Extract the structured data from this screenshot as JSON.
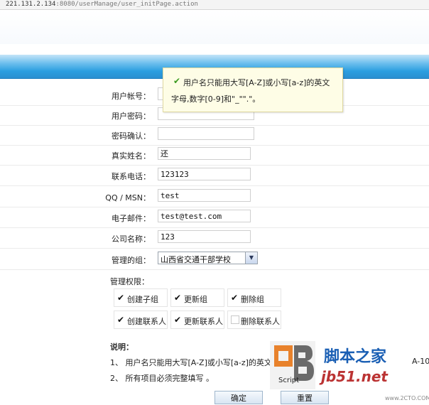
{
  "browser": {
    "url_host": "221.131.2.134",
    "url_path": ":8080/userManage/user_initPage.action"
  },
  "form": {
    "account_label": "用户帐号：",
    "password_label": "用户密码：",
    "confirm_label": "密码确认：",
    "realname_label": "真实姓名：",
    "realname_value": "还",
    "phone_label": "联系电话：",
    "phone_value": "123123",
    "qq_label": "QQ / MSN：",
    "qq_value": "test",
    "email_label": "电子邮件：",
    "email_value": "test@test.com",
    "company_label": "公司名称：",
    "company_value": "123",
    "group_label": "管理的组：",
    "group_selected": "山西省交通干部学校",
    "perm_header": "管理权限：",
    "permissions": [
      {
        "label": "创建子组",
        "checked": true
      },
      {
        "label": "更新组",
        "checked": true
      },
      {
        "label": "删除组",
        "checked": true
      },
      {
        "label": "创建联系人",
        "checked": true
      },
      {
        "label": "更新联系人",
        "checked": true
      },
      {
        "label": "删除联系人",
        "checked": false
      }
    ]
  },
  "tooltip": {
    "line1": "用户名只能用大写[A-Z]或小写[a-z]的英文",
    "line2": "字母,数字[0-9]和\"_\"\".\"。"
  },
  "notes": {
    "title": "说明：",
    "line1": "1、 用户名只能用大写[A-Z]或小写[a-z]的英文",
    "line1_tail": "A-10",
    "line2": "2、  所有项目必须完整填写 。"
  },
  "buttons": {
    "ok": "确定",
    "reset": "重置"
  },
  "watermark": {
    "site": "脚本之家",
    "domain": "jb51.net",
    "script_word": "Script",
    "small": "www.2CTO.COM"
  },
  "colors": {
    "header_blue": "#2b9ee0",
    "tooltip_bg": "#fefde6",
    "check_green": "#3a9a20"
  }
}
